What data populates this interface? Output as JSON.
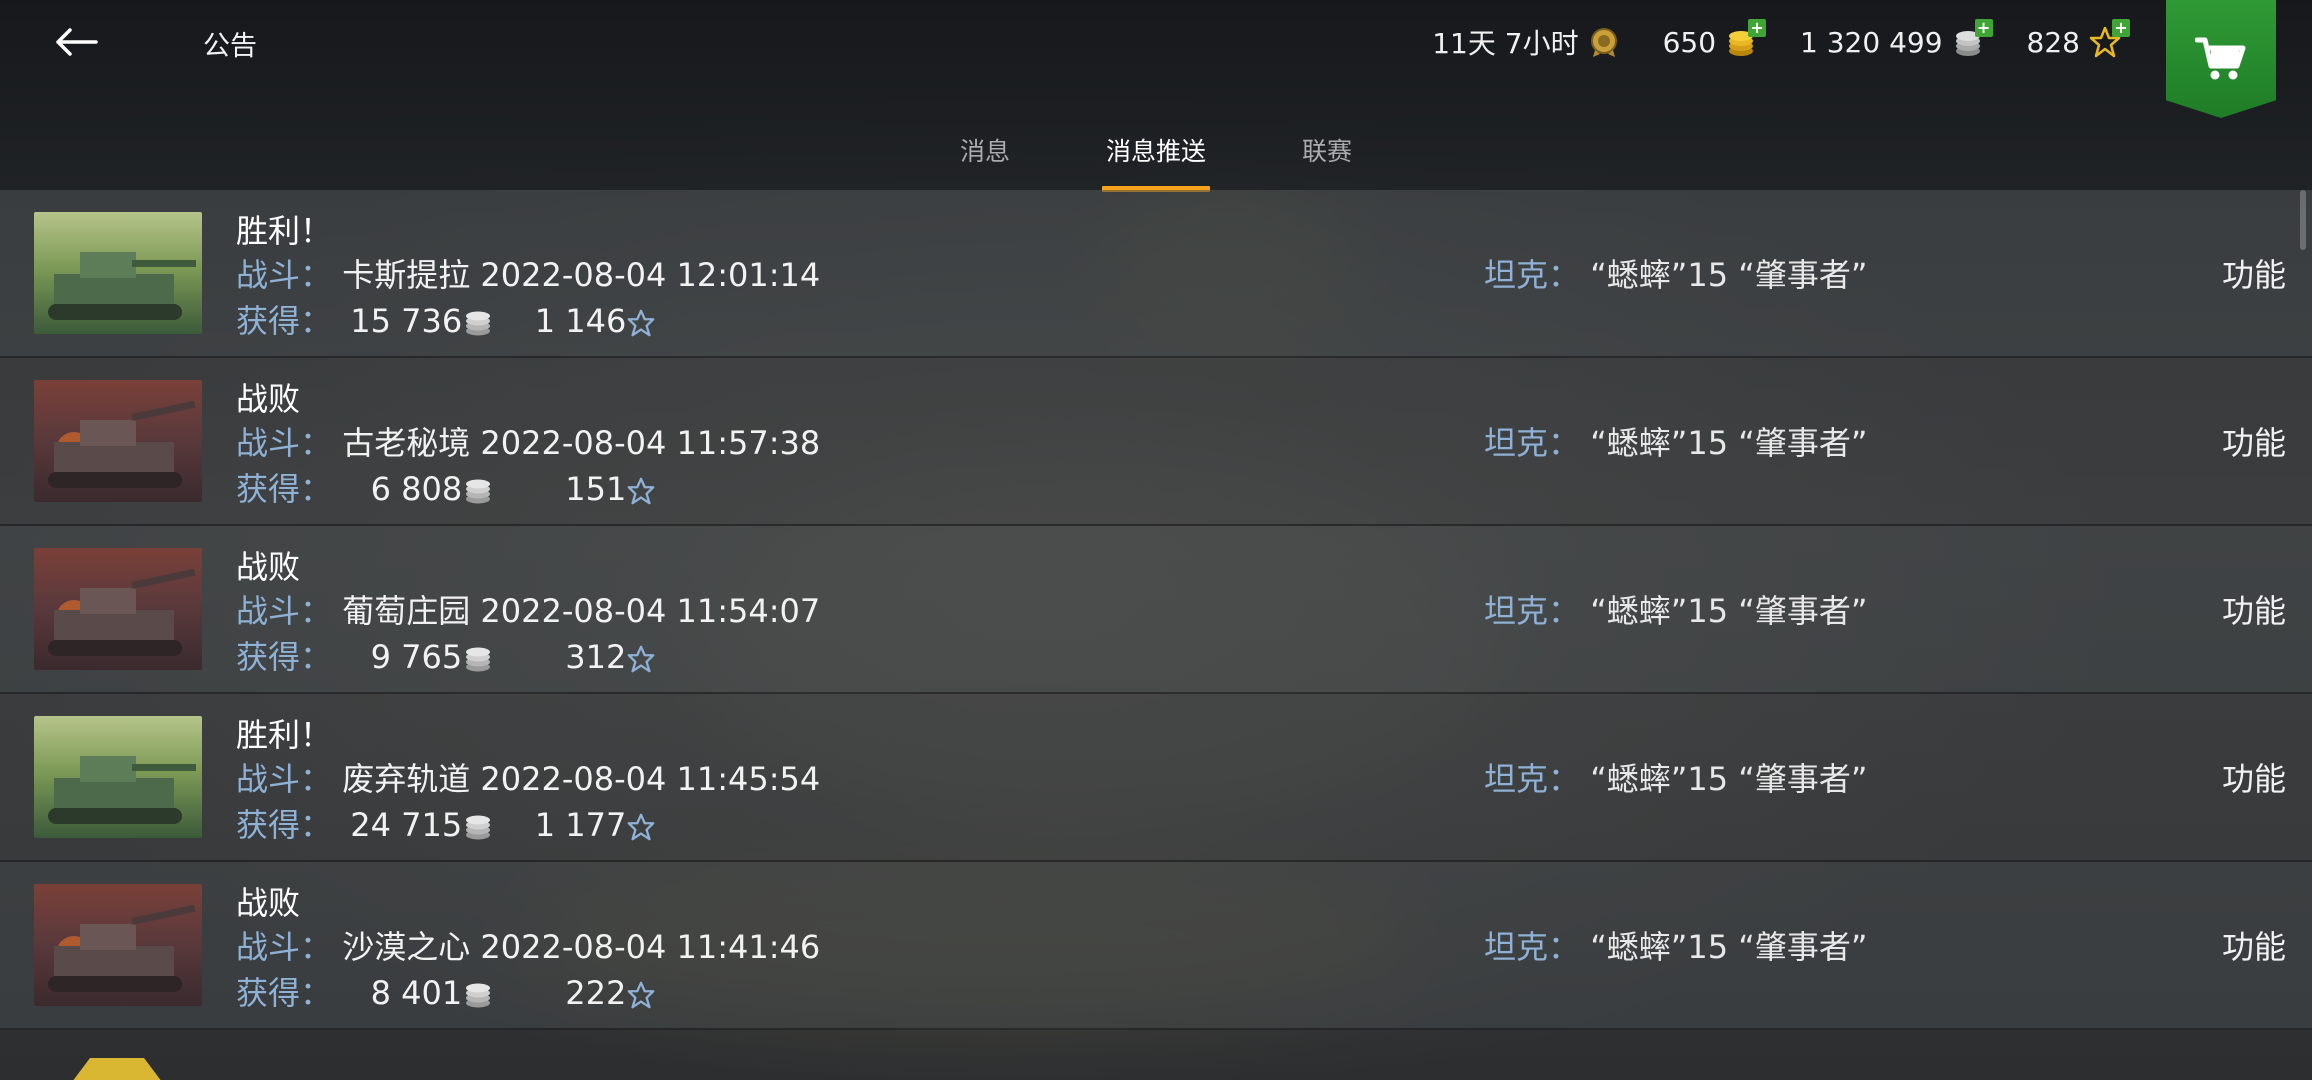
{
  "header": {
    "title": "公告",
    "back_icon": "arrow-left-icon",
    "premium_time": "11天 7小时",
    "gold": "650",
    "silver": "1 320 499",
    "free_xp": "828",
    "cart_icon": "shopping-cart-icon"
  },
  "tabs": [
    {
      "label": "消息",
      "active": false
    },
    {
      "label": "消息推送",
      "active": true
    },
    {
      "label": "联赛",
      "active": false
    }
  ],
  "labels": {
    "battle": "战斗：",
    "earned": "获得：",
    "tank": "坦克：",
    "function": "功能"
  },
  "messages": [
    {
      "result": "胜利！",
      "outcome": "win",
      "map": "卡斯提拉",
      "datetime": "2022-08-04 12:01:14",
      "silver": "15 736",
      "xp": "1 146",
      "tank": "“蟋蟀”15 “肇事者”"
    },
    {
      "result": "战败",
      "outcome": "loss",
      "map": "古老秘境",
      "datetime": "2022-08-04 11:57:38",
      "silver": "6 808",
      "xp": "151",
      "tank": "“蟋蟀”15 “肇事者”"
    },
    {
      "result": "战败",
      "outcome": "loss",
      "map": "葡萄庄园",
      "datetime": "2022-08-04 11:54:07",
      "silver": "9 765",
      "xp": "312",
      "tank": "“蟋蟀”15 “肇事者”"
    },
    {
      "result": "胜利！",
      "outcome": "win",
      "map": "废弃轨道",
      "datetime": "2022-08-04 11:45:54",
      "silver": "24 715",
      "xp": "1 177",
      "tank": "“蟋蟀”15 “肇事者”"
    },
    {
      "result": "战败",
      "outcome": "loss",
      "map": "沙漠之心",
      "datetime": "2022-08-04 11:41:46",
      "silver": "8 401",
      "xp": "222",
      "tank": "“蟋蟀”15 “肇事者”"
    }
  ],
  "colors": {
    "accent_tab": "#f5a31a",
    "label_blue": "#8fb1d6",
    "cart_green": "#2f9a35"
  }
}
